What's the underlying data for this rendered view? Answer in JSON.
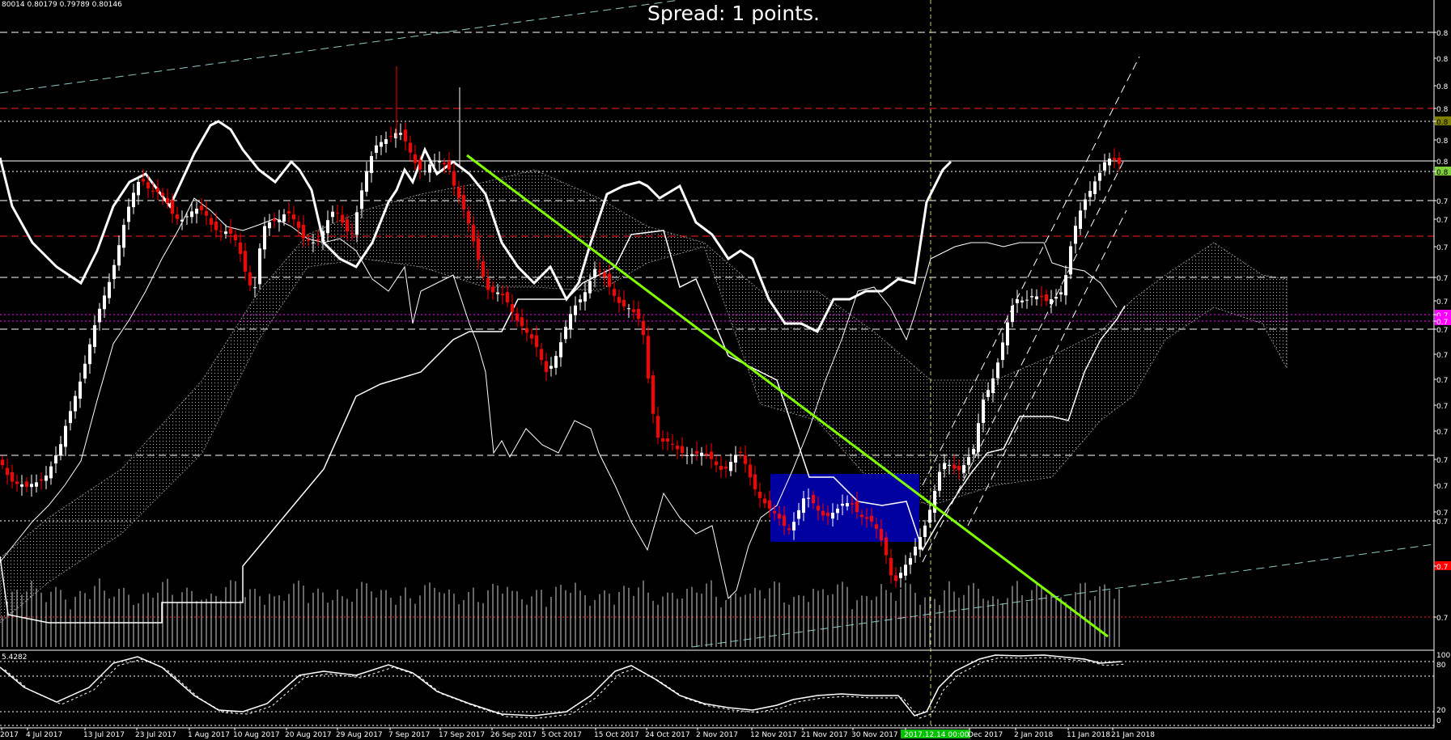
{
  "header": {
    "ohlc_text": "80014 0.80179 0.79789 0.80146",
    "spread_text": "Spread: 1 points."
  },
  "oscillator": {
    "value_text": "5.4282",
    "levels": [
      "100",
      "80",
      "20",
      "0"
    ]
  },
  "price_axis": {
    "labels": [
      {
        "text": "0.8",
        "color": "#ffffff",
        "bg": ""
      },
      {
        "text": "0.8",
        "color": "#ffffff",
        "bg": ""
      },
      {
        "text": "0.8",
        "color": "#ffffff",
        "bg": ""
      },
      {
        "text": "0.8",
        "color": "#ffffff",
        "bg": ""
      },
      {
        "text": "0.8",
        "color": "#000000",
        "bg": "#808000"
      },
      {
        "text": "0.8",
        "color": "#ffffff",
        "bg": ""
      },
      {
        "text": "0.8",
        "color": "#ffffff",
        "bg": ""
      },
      {
        "text": "0.8",
        "color": "#000000",
        "bg": "#7fd13b"
      },
      {
        "text": "0.7",
        "color": "#ffffff",
        "bg": ""
      },
      {
        "text": "0.7",
        "color": "#ffffff",
        "bg": ""
      },
      {
        "text": "0.7",
        "color": "#ffffff",
        "bg": ""
      },
      {
        "text": "0.7",
        "color": "#ffffff",
        "bg": ""
      },
      {
        "text": "0.7",
        "color": "#ffffff",
        "bg": ""
      },
      {
        "text": "0.7",
        "color": "#ffffff",
        "bg": "#ff00ff"
      },
      {
        "text": "0.7",
        "color": "#ffffff",
        "bg": "#ff00ff"
      },
      {
        "text": "0.7",
        "color": "#ffffff",
        "bg": ""
      },
      {
        "text": "0.7",
        "color": "#ffffff",
        "bg": ""
      },
      {
        "text": "0.7",
        "color": "#ffffff",
        "bg": ""
      },
      {
        "text": "0.7",
        "color": "#ffffff",
        "bg": ""
      },
      {
        "text": "0.7",
        "color": "#ffffff",
        "bg": ""
      },
      {
        "text": "0.7",
        "color": "#ffffff",
        "bg": ""
      },
      {
        "text": "0.7",
        "color": "#ffffff",
        "bg": ""
      },
      {
        "text": "0.7",
        "color": "#ffffff",
        "bg": ""
      },
      {
        "text": "0.7",
        "color": "#ffffff",
        "bg": ""
      },
      {
        "text": "0.7",
        "color": "#ffffff",
        "bg": "#ff0000"
      },
      {
        "text": "0.7",
        "color": "#ffffff",
        "bg": ""
      }
    ]
  },
  "colors": {
    "background": "#000000",
    "bull_candle": "#ffffff",
    "bear_candle": "#ff0000",
    "trendline": "#7fff00",
    "range_box": "#0000a0",
    "cloud": "#9a9a9a",
    "grid_dashed": "#ffffff",
    "grid_red": "#ff0000",
    "magenta_level": "#ff00ff",
    "channel_cyan": "#8fc8c8",
    "date_tag": "#00c000"
  },
  "chart_data": {
    "type": "candlestick",
    "title": "",
    "xlabel": "",
    "ylabel": "",
    "x_ticks": [
      "2017",
      "4 Jul 2017",
      "13 Jul 2017",
      "23 Jul 2017",
      "1 Aug 2017",
      "10 Aug 2017",
      "20 Aug 2017",
      "29 Aug 2017",
      "7 Sep 2017",
      "17 Sep 2017",
      "26 Sep 2017",
      "5 Oct 2017",
      "15 Oct 2017",
      "24 Oct 2017",
      "2 Nov 2017",
      "12 Nov 2017",
      "21 Nov 2017",
      "30 Nov 2017",
      "2017.12.14 00:00",
      "Dec 2017",
      "2 Jan 2018",
      "11 Jan 2018",
      "21 Jan 2018"
    ],
    "highlighted_tick": "2017.12.14 00:00",
    "legend": "none",
    "grid": false
  }
}
